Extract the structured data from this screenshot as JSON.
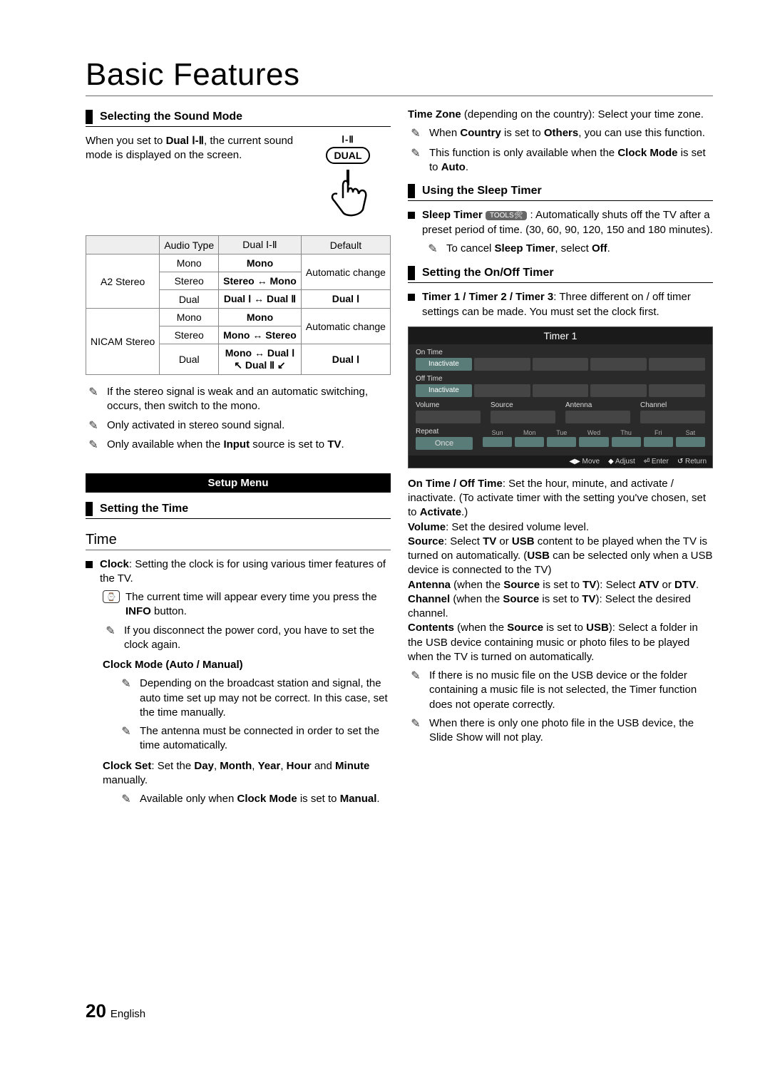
{
  "page": {
    "title": "Basic Features",
    "page_number": "20",
    "language": "English"
  },
  "left": {
    "section1": {
      "heading": "Selecting the Sound Mode",
      "intro_a": "When you set to ",
      "intro_b": "Dual Ⅰ-Ⅱ",
      "intro_c": ", the current sound mode is displayed on the screen.",
      "dual_top": "Ⅰ-Ⅱ",
      "dual_button": "DUAL"
    },
    "table": {
      "h_audio": "Audio Type",
      "h_dual": "Dual Ⅰ-Ⅱ",
      "h_default": "Default",
      "a2_label": "A2 Stereo",
      "a2_r1_c1": "Mono",
      "a2_r1_c2": "Mono",
      "a2_r2_c1": "Stereo",
      "a2_r2_c2": "Stereo ↔ Mono",
      "a2_r3_c1": "Dual",
      "a2_r3_c2": "Dual Ⅰ ↔ Dual Ⅱ",
      "a2_def1": "Automatic change",
      "a2_def2": "Dual Ⅰ",
      "nicam_label": "NICAM Stereo",
      "n_r1_c1": "Mono",
      "n_r1_c2": "Mono",
      "n_r2_c1": "Stereo",
      "n_r2_c2": "Mono ↔ Stereo",
      "n_r3_c1": "Dual",
      "n_r3_c2a": "Mono ↔ Dual Ⅰ",
      "n_r3_c2b": "↖ Dual Ⅱ ↙",
      "n_def1": "Automatic change",
      "n_def2": "Dual Ⅰ"
    },
    "notes": {
      "n1": "If the stereo signal is weak and an automatic switching, occurs, then switch to the mono.",
      "n2": "Only activated in stereo sound signal.",
      "n3_a": "Only available when the ",
      "n3_b": "Input",
      "n3_c": " source is set to ",
      "n3_d": "TV",
      "n3_e": "."
    },
    "setup_banner": "Setup Menu",
    "section2": {
      "heading": "Setting the Time"
    },
    "time_heading": "Time",
    "clock": {
      "lead_b": "Clock",
      "lead_rest": ": Setting the clock is for using various timer features of the TV.",
      "info_a": "The current time will appear every time you press the ",
      "info_b": "INFO",
      "info_c": " button.",
      "disc": "If you disconnect the power cord, you have to set the clock again.",
      "mode_label": "Clock Mode (Auto / Manual)",
      "mode_n1": "Depending on the broadcast station and signal, the auto time set up may not be correct. In this case, set the time manually.",
      "mode_n2": "The antenna must be connected in order to set the time automatically.",
      "set_a": "Clock Set",
      "set_b": ": Set the ",
      "set_c": "Day",
      "set_d": ", ",
      "set_e": "Month",
      "set_f": ", ",
      "set_g": "Year",
      "set_h": ", ",
      "set_i": "Hour",
      "set_j": " and ",
      "set_k": "Minute",
      "set_l": " manually.",
      "avail_a": "Available only when ",
      "avail_b": "Clock Mode",
      "avail_c": " is set to ",
      "avail_d": "Manual",
      "avail_e": "."
    }
  },
  "right": {
    "tz_lead_b": "Time Zone",
    "tz_lead_rest": " (depending on the country): Select your time zone.",
    "tz_n1_a": "When ",
    "tz_n1_b": "Country",
    "tz_n1_c": " is set to ",
    "tz_n1_d": "Others",
    "tz_n1_e": ", you can use this function.",
    "tz_n2_a": "This function is only available when the ",
    "tz_n2_b": "Clock Mode",
    "tz_n2_c": " is set to ",
    "tz_n2_d": "Auto",
    "tz_n2_e": ".",
    "sleep_heading": "Using the Sleep Timer",
    "sleep_b": "Sleep Timer",
    "tools": "TOOLS🛠",
    "sleep_a": " : Automatically shuts off the TV after a preset period of time. (30, 60, 90, 120, 150 and 180 minutes).",
    "sleep_n_a": "To cancel ",
    "sleep_n_b": "Sleep Timer",
    "sleep_n_c": ", select ",
    "sleep_n_d": "Off",
    "sleep_n_e": ".",
    "onoff_heading": "Setting the On/Off Timer",
    "t123_b": "Timer 1 / Timer 2 / Timer 3",
    "t123_rest": ": Three different on / off timer settings can be made. You must set the clock first.",
    "panel": {
      "title": "Timer 1",
      "on_time": "On Time",
      "off_time": "Off Time",
      "inactivate": "Inactivate",
      "volume": "Volume",
      "source": "Source",
      "antenna": "Antenna",
      "channel": "Channel",
      "repeat": "Repeat",
      "once": "Once",
      "days": [
        "Sun",
        "Mon",
        "Tue",
        "Wed",
        "Thu",
        "Fri",
        "Sat"
      ],
      "move": "Move",
      "adjust": "Adjust",
      "enter": "Enter",
      "return": "Return"
    },
    "desc": {
      "onoff_b": "On Time / Off Time",
      "onoff_rest": ": Set the hour, minute, and activate / inactivate. (To activate timer with the setting you've chosen, set to ",
      "onoff_act": "Activate",
      "onoff_end": ".)",
      "vol_b": "Volume",
      "vol_rest": ": Set the desired volume level.",
      "src_b": "Source",
      "src_a": ": Select ",
      "src_tv": "TV",
      "src_or": " or ",
      "src_usb": "USB",
      "src_rest": " content to be played when the TV is turned on automatically. (",
      "src_usb2": "USB",
      "src_rest2": " can be selected only when a USB device is connected to the TV)",
      "ant_b": "Antenna",
      "ant_mid": " (when the ",
      "ant_src": "Source",
      "ant_is": " is set to ",
      "ant_tv": "TV",
      "ant_rest": "): Select ",
      "ant_atv": "ATV",
      "ant_or": " or ",
      "ant_dtv": "DTV",
      "ant_end": ".",
      "ch_b": "Channel",
      "ch_rest": "): Select the desired channel.",
      "cont_b": "Contents",
      "cont_mid": " (when the ",
      "cont_src": "Source",
      "cont_is": " is set to ",
      "cont_usb": "USB",
      "cont_rest": "): Select a folder in the USB device containing music or photo files to be played when the TV is turned on automatically.",
      "note1": "If there is no music file on the USB device or the folder containing a music file is not selected, the Timer function does not operate correctly.",
      "note2": "When there is only one photo file in the USB device, the Slide Show will not play."
    }
  }
}
